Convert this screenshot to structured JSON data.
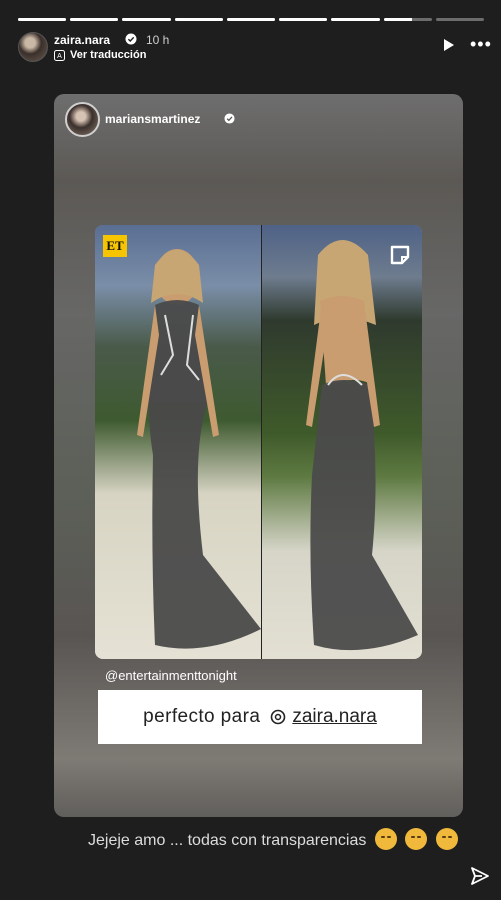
{
  "story": {
    "progress_segments": [
      1,
      1,
      1,
      1,
      1,
      1,
      1,
      0.6,
      0
    ],
    "username": "zaira.nara",
    "time_ago": "10 h",
    "translate_label": "Ver traducción"
  },
  "reshared_post": {
    "username": "mariansmartinez",
    "brand_logo_text": "ET",
    "source_mention": "@entertainmenttonight",
    "caption": "perfecto para",
    "tagged_user": "zaira.nara"
  },
  "story_caption": "Jejeje amo ... todas con transparencias",
  "icons": {
    "verified": "verified-badge-icon",
    "translate": "translate-icon",
    "play": "play-icon",
    "more": "more-icon",
    "threads": "threads-icon",
    "sticker": "sticker-icon",
    "share": "share-icon"
  },
  "colors": {
    "background": "#1e1e1e",
    "verified": "#ffffff",
    "et_logo": "#f6c400"
  }
}
